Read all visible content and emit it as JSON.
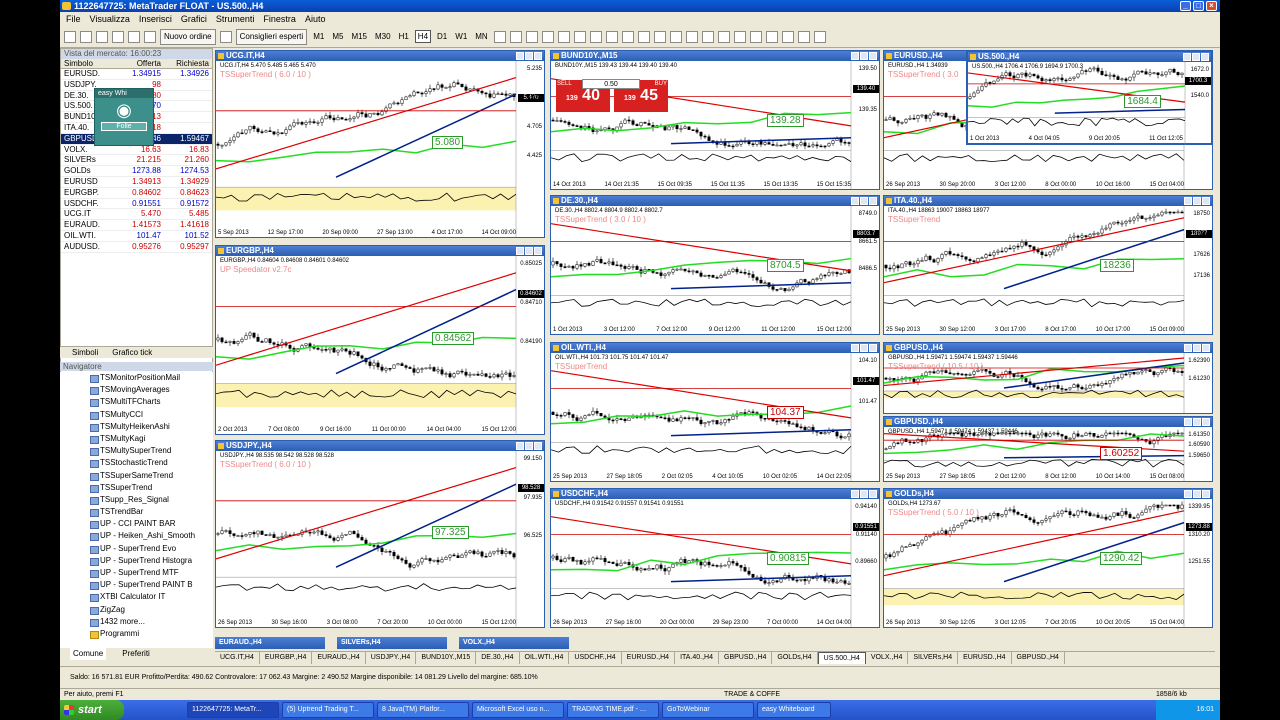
{
  "window": {
    "title": "1122647725: MetaTrader FLOAT - US.500.,H4"
  },
  "menu": [
    "File",
    "Visualizza",
    "Inserisci",
    "Grafici",
    "Strumenti",
    "Finestra",
    "Aiuto"
  ],
  "toolbar": {
    "new_order": "Nuovo ordine",
    "advisors": "Consiglieri esperti",
    "timeframes": [
      "M1",
      "M5",
      "M15",
      "M30",
      "H1",
      "H4",
      "D1",
      "W1",
      "MN"
    ],
    "active_tf": "H4"
  },
  "market_watch": {
    "title": "Vista del mercato: 16:00:23",
    "col_symbol": "Simbolo",
    "col_bid": "Offerta",
    "col_ask": "Richiesta",
    "rows": [
      {
        "s": "EURUSD.",
        "b": "1.34915",
        "a": "1.34926"
      },
      {
        "s": "USDJPY.",
        "b": "98",
        "a": ""
      },
      {
        "s": "DE.30.",
        "b": "880",
        "a": ""
      },
      {
        "s": "US.500.",
        "b": "170",
        "a": ""
      },
      {
        "s": "BUND10Y.",
        "b": "13",
        "a": ""
      },
      {
        "s": "ITA.40.",
        "b": "18",
        "a": ""
      },
      {
        "s": "GBPUSD.",
        "b": "1.59446",
        "a": "1.59467",
        "sel": true
      },
      {
        "s": "VOLX.",
        "b": "16.63",
        "a": "16.83"
      },
      {
        "s": "SILVERs",
        "b": "21.215",
        "a": "21.260"
      },
      {
        "s": "GOLDs",
        "b": "1273.88",
        "a": "1274.53"
      },
      {
        "s": "EURUSD",
        "b": "1.34913",
        "a": "1.34929"
      },
      {
        "s": "EURGBP.",
        "b": "0.84602",
        "a": "0.84623"
      },
      {
        "s": "USDCHF.",
        "b": "0.91551",
        "a": "0.91572"
      },
      {
        "s": "UCG.IT",
        "b": "5.470",
        "a": "5.485"
      },
      {
        "s": "EURAUD.",
        "b": "1.41573",
        "a": "1.41618"
      },
      {
        "s": "OIL.WTI.",
        "b": "101.47",
        "a": "101.52"
      },
      {
        "s": "AUDUSD.",
        "b": "0.95276",
        "a": "0.95297"
      }
    ],
    "tabs": [
      "Simboli",
      "Grafico tick"
    ]
  },
  "alert": {
    "text": "easy Whi",
    "button": "Folle"
  },
  "navigator": {
    "title": "Navigatore",
    "items": [
      "TSMonitorPositionMail",
      "TSMovingAverages",
      "TSMultiTFCharts",
      "TSMultyCCI",
      "TSMultyHeikenAshi",
      "TSMultyKagi",
      "TSMultySuperTrend",
      "TSStochasticTrend",
      "TSSuperSameTrend",
      "TSSuperTrend",
      "TSupp_Res_Signal",
      "TSTrendBar",
      "UP - CCI PAINT BAR",
      "UP - Heiken_Ashi_Smooth",
      "UP - SuperTrend Evo",
      "UP - SuperTrend Histogra",
      "UP - SuperTrend MTF",
      "UP - SuperTrend PAINT B",
      "XTBI Calculator IT",
      "ZigZag",
      "1432 more...",
      "Programmi"
    ],
    "tabs": [
      "Comune",
      "Preferiti"
    ]
  },
  "charts": [
    {
      "title": "UCG.IT,H4",
      "sym": "UCG.IT,H4 5.470 5.485 5.465 5.470",
      "ts": "TSSuperTrend ( 6.0 / 10 )",
      "dates": [
        "5 Sep 2013",
        "12 Sep 17:00",
        "20 Sep 09:00",
        "27 Sep 13:00",
        "4 Oct 17:00",
        "14 Oct 09:00"
      ],
      "lvl": "5.080",
      "prices": [
        "5.235",
        "4.975",
        "4.705",
        "4.425"
      ],
      "cur": "5.470"
    },
    {
      "title": "BUND10Y.,M15",
      "sym": "BUND10Y.,M15 139.43 139.44 139.40 139.40",
      "dates": [
        "14 Oct 2013",
        "14 Oct 21:35",
        "15 Oct 09:35",
        "15 Oct 11:35",
        "15 Oct 13:35",
        "15 Oct 15:35"
      ],
      "lvl": "139.28",
      "prices": [
        "139.50",
        "139.35"
      ],
      "cur": "139.40"
    },
    {
      "title": "EURUSD.,H4",
      "sym": "EURUSD.,H4 1.34939",
      "ts": "TSSuperTrend ( 3.0",
      "dates": [
        "26 Sep 2013",
        "30 Sep 20:00",
        "3 Oct 12:00",
        "8 Oct 00:00",
        "10 Oct 16:00",
        "15 Oct 04:00"
      ],
      "prices": [
        "1.34700"
      ],
      "cur": ""
    },
    {
      "title": "US.500.,H4",
      "sym": "US.500.,H4 1706.4 1706.9 1694.9 1700.3",
      "dates": [
        "1 Oct 2013",
        "4 Oct 04:05",
        "9 Oct 20:05",
        "11 Oct 12:05"
      ],
      "lvl": "1684.4",
      "prices": [
        "1672.0",
        "1540.0"
      ],
      "cur": "1700.3"
    },
    {
      "title": "EURGBP.,H4",
      "sym": "EURGBP.,H4 0.84604 0.84608 0.84601 0.84602",
      "ts": "UP Speedator v2.7c",
      "dates": [
        "2 Oct 2013",
        "7 Oct 08:00",
        "9 Oct 16:00",
        "11 Oct 00:00",
        "14 Oct 04:00",
        "15 Oct 12:00"
      ],
      "lvl": "0.84562",
      "prices": [
        "0.85025",
        "0.84710",
        "0.84190"
      ],
      "cur": "0.84602"
    },
    {
      "title": "DE.30.,H4",
      "sym": "DE.30.,H4 8802.4 8804.9 8802.4 8802.7",
      "ts": "TSSuperTrend ( 3.0 / 10 )",
      "dates": [
        "1 Oct 2013",
        "3 Oct 12:00",
        "7 Oct 12:00",
        "9 Oct 12:00",
        "11 Oct 12:00",
        "15 Oct 12:00"
      ],
      "lvl": "8704.5",
      "prices": [
        "8749.0",
        "8661.5",
        "8486.5"
      ],
      "cur": "8803.7"
    },
    {
      "title": "ITA.40.,H4",
      "sym": "ITA.40.,H4 18863 19007 18863 18977",
      "ts": "TSSuperTrend",
      "dates": [
        "25 Sep 2013",
        "30 Sep 12:00",
        "3 Oct 17:00",
        "8 Oct 17:00",
        "10 Oct 17:00",
        "15 Oct 09:00"
      ],
      "lvl": "18236",
      "prices": [
        "18750",
        "18116",
        "17626",
        "17136"
      ],
      "cur": "18977"
    },
    {
      "title": "OIL.WTI.,H4",
      "sym": "OIL.WTI.,H4 101.73 101.75 101.47 101.47",
      "ts": "TSSuperTrend",
      "dates": [
        "25 Sep 2013",
        "27 Sep 18:05",
        "2 Oct 02:05",
        "4 Oct 10:05",
        "10 Oct 02:05",
        "14 Oct 22:05"
      ],
      "lvl": "104.37",
      "prices": [
        "104.10",
        "101.47"
      ],
      "cur": "101.47"
    },
    {
      "title": "GBPUSD.,H4",
      "sym": "GBPUSD.,H4 1.59471 1.59474 1.59437 1.59446",
      "ts": "TSSuperTrend ( 10.5 / 10 )",
      "dates": [],
      "prices": [
        "1.62390",
        "1.61230"
      ],
      "cur": ""
    },
    {
      "title": "GBPUSD.,H4",
      "sym": "GBPUSD.,H4 1.59471 1.59474 1.59437 1.59446",
      "dates": [
        "25 Sep 2013",
        "27 Sep 18:05",
        "2 Oct 12:00",
        "8 Oct 12:00",
        "10 Oct 14:00",
        "15 Oct 08:00"
      ],
      "lvl": "1.60252",
      "prices": [
        "1.61350",
        "1.60590",
        "1.59650"
      ],
      "cur": ""
    },
    {
      "title": "USDJPY.,H4",
      "sym": "USDJPY.,H4 98.535 98.542 98.528 98.528",
      "ts": "TSSuperTrend ( 6.0 / 10 )",
      "dates": [
        "26 Sep 2013",
        "30 Sep 16:00",
        "3 Oct 08:00",
        "7 Oct 20:00",
        "10 Oct 00:00",
        "15 Oct 12:00"
      ],
      "lvl": "97.325",
      "prices": [
        "99.150",
        "97.935",
        "96.525"
      ],
      "cur": "98.528"
    },
    {
      "title": "USDCHF.,H4",
      "sym": "USDCHF.,H4 0.91542 0.91557 0.91541 0.91551",
      "dates": [
        "26 Sep 2013",
        "27 Sep 16:00",
        "20 Oct 00:00",
        "29 Sep 23:00",
        "7 Oct 00:00",
        "14 Oct 04:00"
      ],
      "lvl": "0.90815",
      "prices": [
        "0.94140",
        "0.91140",
        "0.89660"
      ],
      "cur": "0.91551"
    },
    {
      "title": "GOLDs,H4",
      "sym": "GOLDs,H4 1273.67",
      "ts": "TSSuperTrend ( 5.0 / 10 )",
      "dates": [
        "26 Sep 2013",
        "30 Sep 12:05",
        "3 Oct 12:05",
        "7 Oct 20:05",
        "10 Oct 20:05",
        "15 Oct 04:00"
      ],
      "lvl": "1290.42",
      "prices": [
        "1339.95",
        "1310.20",
        "1251.55"
      ],
      "cur": "1273.88"
    }
  ],
  "trade_panel": {
    "sell": "SELL",
    "buy": "BUY",
    "lot": "0.50",
    "sell_price": "40",
    "buy_price": "45",
    "sell_big": "139",
    "buy_big": "139"
  },
  "chart_tabs": [
    "UCG.IT,H4",
    "EURGBP.,H4",
    "EURAUD.,H4",
    "USDJPY.,H4",
    "BUND10Y.,M15",
    "DE.30.,H4",
    "OIL.WTI.,H4",
    "USDCHF.,H4",
    "EURUSD.,H4",
    "ITA.40.,H4",
    "GBPUSD.,H4",
    "GOLDs,H4",
    "US.500.,H4",
    "VOLX.,H4",
    "SILVERs,H4",
    "EURUSD.,H4",
    "GBPUSD.,H4"
  ],
  "active_chart_tab": "US.500.,H4",
  "status_info": "Saldo: 16 571.81 EUR  Profitto/Perdita: 490.62  Controvalore: 17 062.43  Margine: 2 490.52  Margine disponibile: 14 081.29  Livello del margine: 685.10%",
  "statusbar": {
    "help": "Per aiuto, premi F1",
    "mode": "TRADE & COFFE",
    "traffic": "1858/6 kb"
  },
  "min_tabs": [
    "EURAUD.,H4",
    "SILVERs,H4",
    "VOLX.,H4"
  ],
  "taskbar": {
    "start": "start",
    "items": [
      "1122647725: MetaTr...",
      "(5) Uptrend Trading T...",
      "8 Java(TM) Platfor...",
      "Microsoft Excel uso n...",
      "TRADING TIME.pdf - ...",
      "GoToWebinar",
      "easy Whiteboard"
    ],
    "clock": "16:01"
  }
}
